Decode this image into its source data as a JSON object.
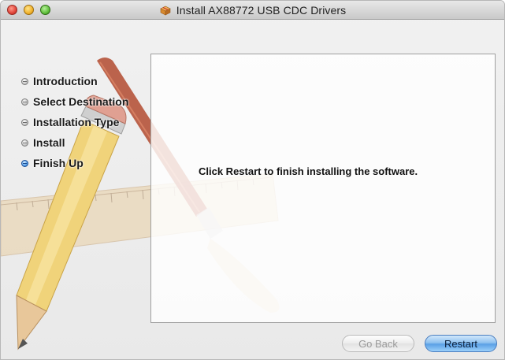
{
  "window": {
    "title": "Install AX88772 USB CDC Drivers",
    "controls": [
      "close-button",
      "minimize-button",
      "zoom-button"
    ]
  },
  "sidebar": {
    "steps": [
      {
        "label": "Introduction",
        "state": "completed"
      },
      {
        "label": "Select Destination",
        "state": "completed"
      },
      {
        "label": "Installation Type",
        "state": "completed"
      },
      {
        "label": "Install",
        "state": "completed"
      },
      {
        "label": "Finish Up",
        "state": "active"
      }
    ]
  },
  "main": {
    "message": "Click Restart to finish installing the software."
  },
  "buttons": {
    "go_back": "Go Back",
    "restart": "Restart"
  },
  "colors": {
    "active_bullet": "#4a97e6",
    "primary_button": "#5aa0e6"
  }
}
